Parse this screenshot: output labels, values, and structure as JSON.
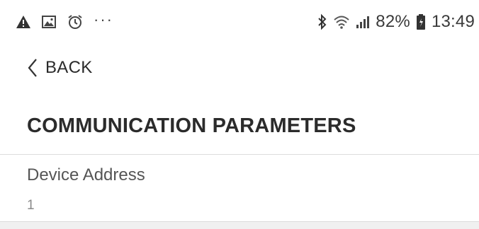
{
  "status_bar": {
    "left_icons": [
      "warning-icon",
      "image-icon",
      "alarm-icon",
      "more-icon"
    ],
    "right_icons": [
      "bluetooth-icon",
      "wifi-icon",
      "signal-icon",
      "battery-icon"
    ],
    "battery_percent": "82%",
    "time": "13:49"
  },
  "nav": {
    "back_label": "BACK"
  },
  "page": {
    "title": "COMMUNICATION PARAMETERS"
  },
  "settings": [
    {
      "label": "Device Address",
      "value": "1"
    }
  ],
  "colors": {
    "text_primary": "#2b2b2b",
    "text_secondary": "#8a8a8a",
    "divider": "#dcdcdc",
    "background": "#ffffff"
  }
}
